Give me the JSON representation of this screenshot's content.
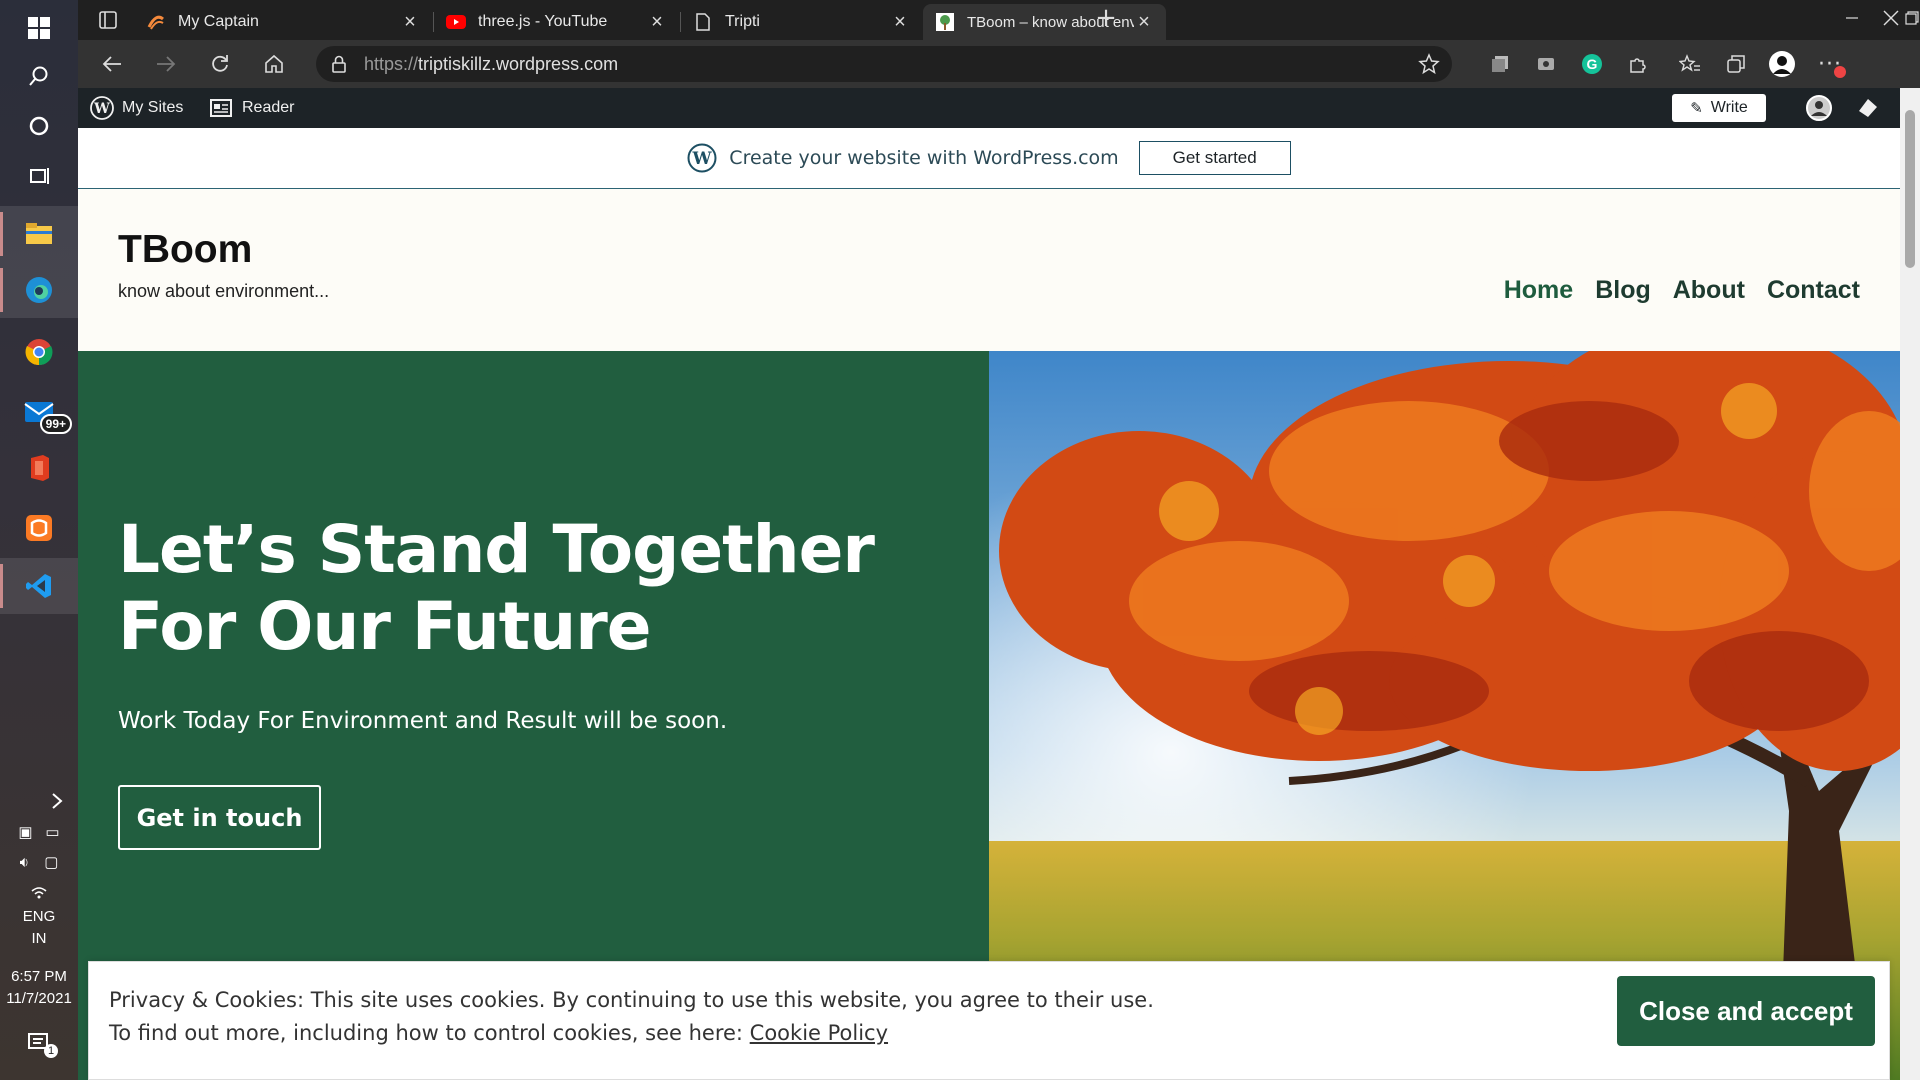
{
  "browser": {
    "tabs": [
      {
        "title": "My Captain",
        "icon": "mycaptain-favicon-icon"
      },
      {
        "title": "three.js - YouTube",
        "icon": "youtube-favicon-icon"
      },
      {
        "title": "Tripti",
        "icon": "page-icon"
      },
      {
        "title": "TBoom – know about environme",
        "icon": "site-favicon-icon",
        "active": true
      }
    ],
    "address": {
      "scheme": "https://",
      "host": "triptiskillz.wordpress.com"
    }
  },
  "wp_admin_bar": {
    "my_sites": "My Sites",
    "reader": "Reader",
    "write": "Write"
  },
  "promo": {
    "text": "Create your website with WordPress.com",
    "button": "Get started"
  },
  "site": {
    "title": "TBoom",
    "tagline": "know about environment..."
  },
  "nav": {
    "items": [
      "Home",
      "Blog",
      "About",
      "Contact"
    ]
  },
  "hero": {
    "heading": "Let’s Stand Together For Our Future",
    "subtext": "Work Today For Environment and Result will be soon.",
    "button": "Get in touch"
  },
  "cookie": {
    "line1": "Privacy & Cookies: This site uses cookies. By continuing to use this website, you agree to their use.",
    "line2_prefix": "To find out more, including how to control cookies, see here: ",
    "link": "Cookie Policy",
    "button": "Close and accept"
  },
  "taskbar": {
    "mail_badge": "99+",
    "lang": "ENG",
    "region": "IN",
    "time": "6:57 PM",
    "date": "11/7/2021",
    "notif_count": "1"
  },
  "colors": {
    "accent_green": "#215e3f",
    "wpbar": "#1d2327"
  }
}
